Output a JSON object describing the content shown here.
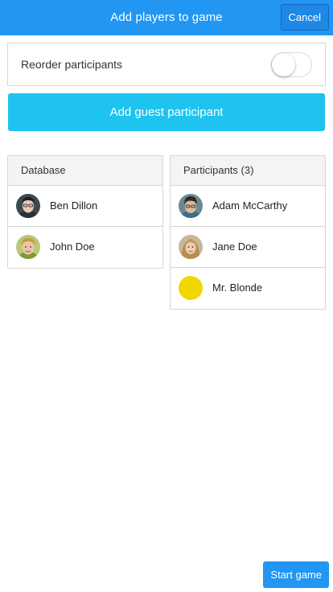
{
  "header": {
    "title": "Add players to game",
    "cancel_label": "Cancel",
    "color": "#2196f3"
  },
  "reorder": {
    "label": "Reorder participants",
    "enabled": false
  },
  "add_guest": {
    "label": "Add guest participant",
    "color": "#1ec3f0"
  },
  "database": {
    "title": "Database",
    "items": [
      {
        "name": "Ben Dillon",
        "avatar": "photo-avatar"
      },
      {
        "name": "John Doe",
        "avatar": "photo-avatar"
      }
    ]
  },
  "participants": {
    "title": "Participants (3)",
    "items": [
      {
        "name": "Adam McCarthy",
        "avatar": "photo-avatar"
      },
      {
        "name": "Jane Doe",
        "avatar": "photo-avatar"
      },
      {
        "name": "Mr. Blonde",
        "avatar": "yellow-circle-avatar",
        "avatar_color": "#f2d600"
      }
    ]
  },
  "footer": {
    "start_label": "Start game"
  }
}
